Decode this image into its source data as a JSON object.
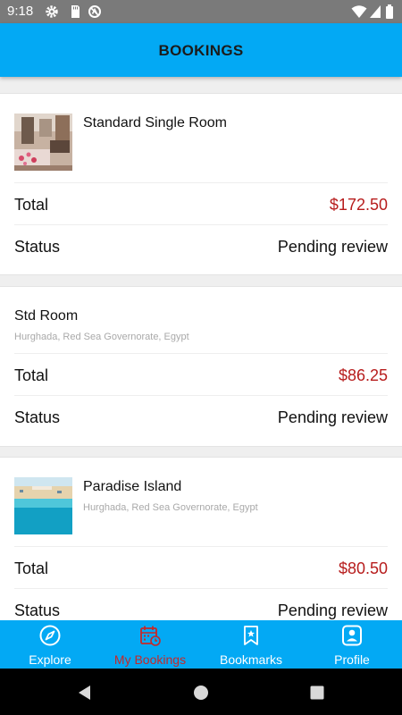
{
  "status_bar": {
    "time": "9:18",
    "left_icons": [
      "gear-icon",
      "sd-card-icon",
      "no-sync-icon"
    ],
    "right_icons": [
      "wifi-icon",
      "signal-icon",
      "battery-icon"
    ]
  },
  "app_bar": {
    "title": "BOOKINGS"
  },
  "bookings": [
    {
      "name": "Standard Single Room",
      "location": "",
      "has_image": true,
      "total_label": "Total",
      "total": "$172.50",
      "status_label": "Status",
      "status": "Pending review"
    },
    {
      "name": "Std Room",
      "location": "Hurghada, Red Sea Governorate, Egypt",
      "has_image": false,
      "total_label": "Total",
      "total": "$86.25",
      "status_label": "Status",
      "status": "Pending review"
    },
    {
      "name": "Paradise Island",
      "location": "Hurghada, Red Sea Governorate, Egypt",
      "has_image": true,
      "total_label": "Total",
      "total": "$80.50",
      "status_label": "Status",
      "status": "Pending review"
    }
  ],
  "bottom_nav": {
    "items": [
      {
        "label": "Explore",
        "icon": "compass-icon",
        "active": false
      },
      {
        "label": "My Bookings",
        "icon": "calendar-clock-icon",
        "active": true
      },
      {
        "label": "Bookmarks",
        "icon": "bookmark-star-icon",
        "active": false
      },
      {
        "label": "Profile",
        "icon": "profile-icon",
        "active": false
      }
    ]
  },
  "colors": {
    "primary": "#03a9f4",
    "price": "#b71c1c",
    "active_nav": "#c62828",
    "status_bar": "#7a7a7a"
  },
  "system_nav": [
    "back-icon",
    "home-icon",
    "recents-icon"
  ]
}
